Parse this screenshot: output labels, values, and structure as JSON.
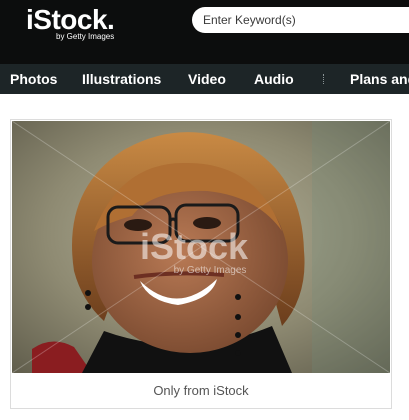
{
  "header": {
    "logo_text": "iStock.",
    "logo_subtext": "by Getty Images",
    "search_placeholder": "Enter Keyword(s)"
  },
  "nav": {
    "items": [
      {
        "label": "Photos"
      },
      {
        "label": "Illustrations"
      },
      {
        "label": "Video"
      },
      {
        "label": "Audio"
      },
      {
        "label": "Plans and"
      }
    ]
  },
  "card": {
    "watermark_text": "iStock",
    "watermark_subtext": "by Getty Images",
    "caption": "Only from iStock"
  },
  "colors": {
    "topbar": "#0c0d0d",
    "navbar": "#1d2527"
  }
}
